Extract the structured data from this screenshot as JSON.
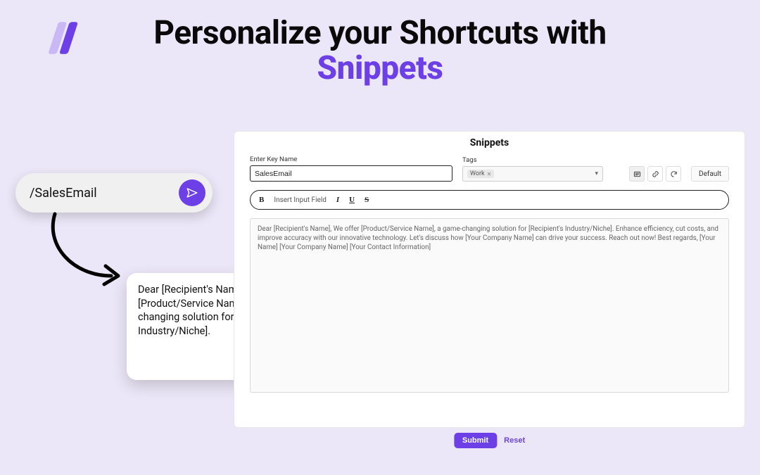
{
  "headline": {
    "line1": "Personalize your Shortcuts with",
    "line2": "Snippets"
  },
  "shortcut_pill": {
    "text": "/SalesEmail"
  },
  "preview_card": {
    "text": "Dear [Recipient's Name], We offer [Product/Service Name], a game-changing solution for [Recipient's Industry/Niche]."
  },
  "panel": {
    "title": "Snippets",
    "keyname": {
      "label": "Enter Key Name",
      "value": "SalesEmail"
    },
    "tags": {
      "label": "Tags",
      "selected": "Work"
    },
    "toolbar": {
      "bold": "B",
      "insert_label": "Insert Input Field",
      "italic": "I",
      "underline": "U",
      "strike": "S"
    },
    "mode_group": {
      "default_label": "Default"
    },
    "body_text": "Dear [Recipient's Name], We offer [Product/Service Name], a game-changing solution for [Recipient's Industry/Niche]. Enhance efficiency, cut costs, and improve accuracy with our innovative technology. Let's discuss how [Your Company Name] can drive your success. Reach out now! Best regards, [Your Name] [Your Company Name] [Your Contact Information]",
    "submit_label": "Submit",
    "reset_label": "Reset"
  }
}
